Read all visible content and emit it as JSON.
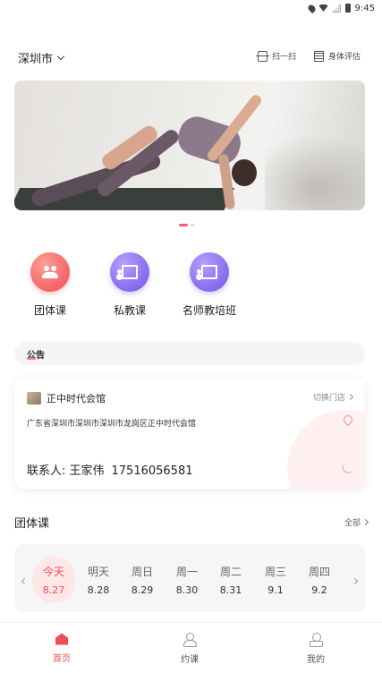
{
  "status_bar": {
    "time": "9:45"
  },
  "header": {
    "city": "深圳市",
    "scan_label": "扫一扫",
    "body_eval_label": "身体评估"
  },
  "banner": {
    "slide_count": 2,
    "active_slide": 1
  },
  "categories": [
    {
      "label": "团体课",
      "icon": "group-icon",
      "color": "#ef4c55"
    },
    {
      "label": "私教课",
      "icon": "coach-board-icon",
      "color": "#7453e8"
    },
    {
      "label": "名师教培班",
      "icon": "coach-board-icon",
      "color": "#7453e8"
    }
  ],
  "notice": {
    "label": "公告"
  },
  "venue": {
    "name": "正中时代会馆",
    "switch_label": "切换门店",
    "address": "广东省深圳市深圳市深圳市龙岗区正中时代会馆",
    "contact_label": "联系人: 王家伟",
    "phone": "17516056581"
  },
  "group_section": {
    "title": "团体课",
    "all_label": "全部"
  },
  "dates": [
    {
      "day": "今天",
      "date": "8.27",
      "active": true
    },
    {
      "day": "明天",
      "date": "8.28",
      "active": false
    },
    {
      "day": "周日",
      "date": "8.29",
      "active": false
    },
    {
      "day": "周一",
      "date": "8.30",
      "active": false
    },
    {
      "day": "周二",
      "date": "8.31",
      "active": false
    },
    {
      "day": "周三",
      "date": "9.1",
      "active": false
    },
    {
      "day": "周四",
      "date": "9.2",
      "active": false
    }
  ],
  "tabbar": [
    {
      "label": "首页",
      "icon": "home-icon",
      "active": true
    },
    {
      "label": "约课",
      "icon": "booking-icon",
      "active": false
    },
    {
      "label": "我的",
      "icon": "profile-icon",
      "active": false
    }
  ],
  "colors": {
    "accent": "#ef4c55",
    "purple": "#7453e8"
  }
}
